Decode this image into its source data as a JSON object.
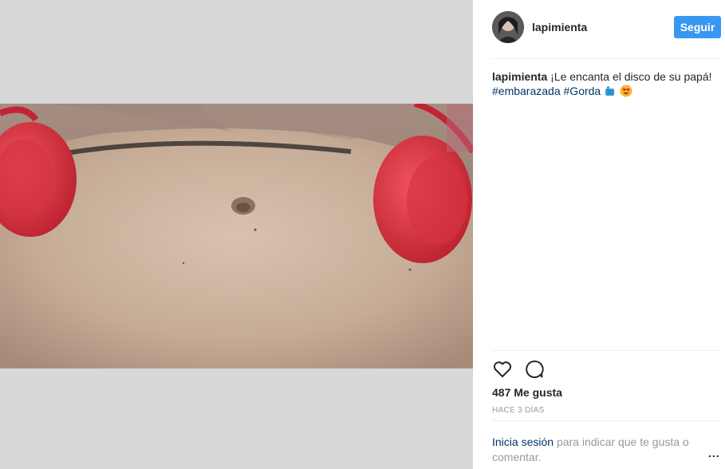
{
  "post": {
    "username": "lapimienta",
    "follow_label": "Seguir",
    "caption": {
      "username": "lapimienta",
      "text": "¡Le encanta el disco de su papá!",
      "hashtag_1": "#embarazada",
      "hashtag_2": "#Gorda",
      "emojis": [
        "fist-icon",
        "heart-eyes-face-icon"
      ]
    },
    "likes": "487 Me gusta",
    "timestamp": "HACE 3 DÍAS",
    "login_prompt": {
      "link": "Inicia sesión",
      "rest": "para indicar que te gusta o comentar."
    },
    "more_label": "..."
  },
  "colors": {
    "accent": "#3897f0",
    "hashtag": "#003569",
    "text": "#262626",
    "muted": "#999999",
    "media_background": "#d8d8d8",
    "headphones": "#e23a46"
  }
}
